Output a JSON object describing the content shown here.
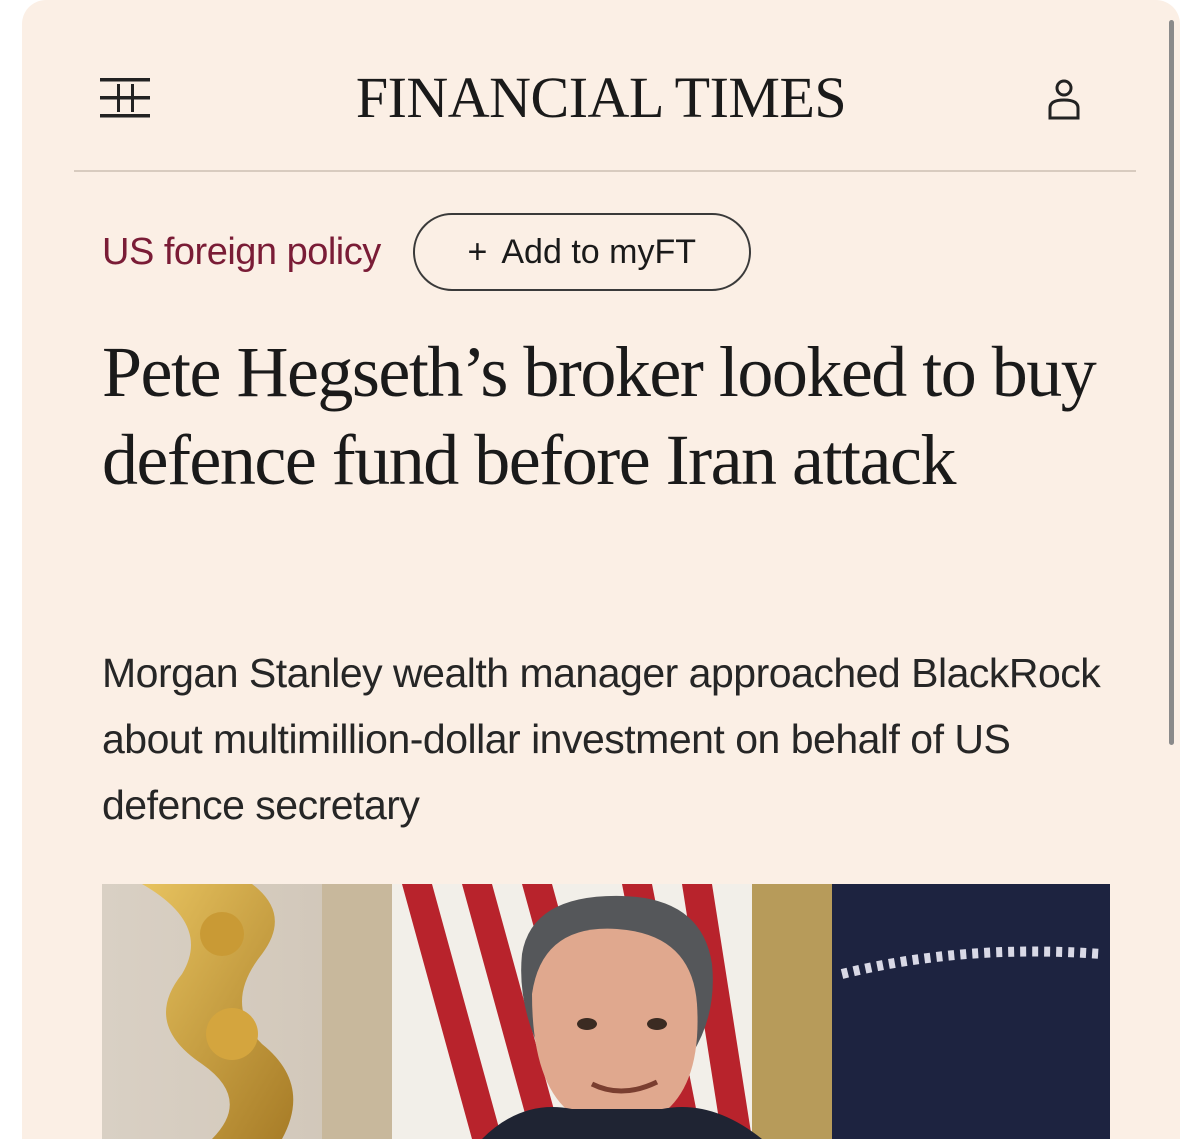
{
  "header": {
    "masthead": "FINANCIAL TIMES",
    "menu_icon": "hamburger-menu-icon",
    "account_icon": "user-icon"
  },
  "article": {
    "topic": "US foreign policy",
    "myft_button": {
      "icon": "+",
      "label": "Add to myFT"
    },
    "headline": "Pete Hegseth’s broker looked to buy defence fund before Iran attack",
    "standfirst": "Morgan Stanley wealth manager approached BlackRock about multimillion-dollar investment on behalf of US defence secretary",
    "image": {
      "content": "photo"
    }
  },
  "colors": {
    "background": "#fbefe5",
    "topic": "#7a1c36",
    "text": "#1a1a1a",
    "divider": "#d8cbbf"
  }
}
